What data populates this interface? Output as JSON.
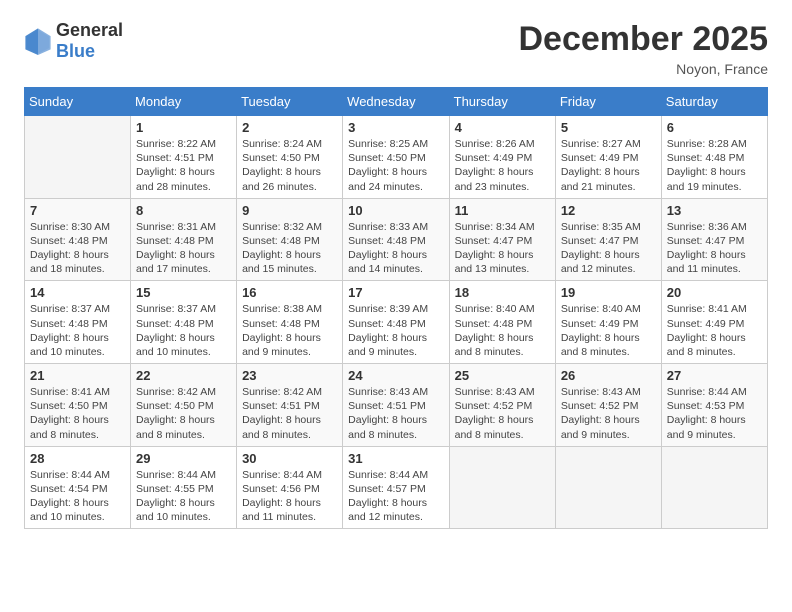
{
  "header": {
    "logo_general": "General",
    "logo_blue": "Blue",
    "title": "December 2025",
    "location": "Noyon, France"
  },
  "days_of_week": [
    "Sunday",
    "Monday",
    "Tuesday",
    "Wednesday",
    "Thursday",
    "Friday",
    "Saturday"
  ],
  "weeks": [
    [
      {
        "day": "",
        "empty": true
      },
      {
        "day": "1",
        "sunrise": "Sunrise: 8:22 AM",
        "sunset": "Sunset: 4:51 PM",
        "daylight": "Daylight: 8 hours and 28 minutes."
      },
      {
        "day": "2",
        "sunrise": "Sunrise: 8:24 AM",
        "sunset": "Sunset: 4:50 PM",
        "daylight": "Daylight: 8 hours and 26 minutes."
      },
      {
        "day": "3",
        "sunrise": "Sunrise: 8:25 AM",
        "sunset": "Sunset: 4:50 PM",
        "daylight": "Daylight: 8 hours and 24 minutes."
      },
      {
        "day": "4",
        "sunrise": "Sunrise: 8:26 AM",
        "sunset": "Sunset: 4:49 PM",
        "daylight": "Daylight: 8 hours and 23 minutes."
      },
      {
        "day": "5",
        "sunrise": "Sunrise: 8:27 AM",
        "sunset": "Sunset: 4:49 PM",
        "daylight": "Daylight: 8 hours and 21 minutes."
      },
      {
        "day": "6",
        "sunrise": "Sunrise: 8:28 AM",
        "sunset": "Sunset: 4:48 PM",
        "daylight": "Daylight: 8 hours and 19 minutes."
      }
    ],
    [
      {
        "day": "7",
        "sunrise": "Sunrise: 8:30 AM",
        "sunset": "Sunset: 4:48 PM",
        "daylight": "Daylight: 8 hours and 18 minutes."
      },
      {
        "day": "8",
        "sunrise": "Sunrise: 8:31 AM",
        "sunset": "Sunset: 4:48 PM",
        "daylight": "Daylight: 8 hours and 17 minutes."
      },
      {
        "day": "9",
        "sunrise": "Sunrise: 8:32 AM",
        "sunset": "Sunset: 4:48 PM",
        "daylight": "Daylight: 8 hours and 15 minutes."
      },
      {
        "day": "10",
        "sunrise": "Sunrise: 8:33 AM",
        "sunset": "Sunset: 4:48 PM",
        "daylight": "Daylight: 8 hours and 14 minutes."
      },
      {
        "day": "11",
        "sunrise": "Sunrise: 8:34 AM",
        "sunset": "Sunset: 4:47 PM",
        "daylight": "Daylight: 8 hours and 13 minutes."
      },
      {
        "day": "12",
        "sunrise": "Sunrise: 8:35 AM",
        "sunset": "Sunset: 4:47 PM",
        "daylight": "Daylight: 8 hours and 12 minutes."
      },
      {
        "day": "13",
        "sunrise": "Sunrise: 8:36 AM",
        "sunset": "Sunset: 4:47 PM",
        "daylight": "Daylight: 8 hours and 11 minutes."
      }
    ],
    [
      {
        "day": "14",
        "sunrise": "Sunrise: 8:37 AM",
        "sunset": "Sunset: 4:48 PM",
        "daylight": "Daylight: 8 hours and 10 minutes."
      },
      {
        "day": "15",
        "sunrise": "Sunrise: 8:37 AM",
        "sunset": "Sunset: 4:48 PM",
        "daylight": "Daylight: 8 hours and 10 minutes."
      },
      {
        "day": "16",
        "sunrise": "Sunrise: 8:38 AM",
        "sunset": "Sunset: 4:48 PM",
        "daylight": "Daylight: 8 hours and 9 minutes."
      },
      {
        "day": "17",
        "sunrise": "Sunrise: 8:39 AM",
        "sunset": "Sunset: 4:48 PM",
        "daylight": "Daylight: 8 hours and 9 minutes."
      },
      {
        "day": "18",
        "sunrise": "Sunrise: 8:40 AM",
        "sunset": "Sunset: 4:48 PM",
        "daylight": "Daylight: 8 hours and 8 minutes."
      },
      {
        "day": "19",
        "sunrise": "Sunrise: 8:40 AM",
        "sunset": "Sunset: 4:49 PM",
        "daylight": "Daylight: 8 hours and 8 minutes."
      },
      {
        "day": "20",
        "sunrise": "Sunrise: 8:41 AM",
        "sunset": "Sunset: 4:49 PM",
        "daylight": "Daylight: 8 hours and 8 minutes."
      }
    ],
    [
      {
        "day": "21",
        "sunrise": "Sunrise: 8:41 AM",
        "sunset": "Sunset: 4:50 PM",
        "daylight": "Daylight: 8 hours and 8 minutes."
      },
      {
        "day": "22",
        "sunrise": "Sunrise: 8:42 AM",
        "sunset": "Sunset: 4:50 PM",
        "daylight": "Daylight: 8 hours and 8 minutes."
      },
      {
        "day": "23",
        "sunrise": "Sunrise: 8:42 AM",
        "sunset": "Sunset: 4:51 PM",
        "daylight": "Daylight: 8 hours and 8 minutes."
      },
      {
        "day": "24",
        "sunrise": "Sunrise: 8:43 AM",
        "sunset": "Sunset: 4:51 PM",
        "daylight": "Daylight: 8 hours and 8 minutes."
      },
      {
        "day": "25",
        "sunrise": "Sunrise: 8:43 AM",
        "sunset": "Sunset: 4:52 PM",
        "daylight": "Daylight: 8 hours and 8 minutes."
      },
      {
        "day": "26",
        "sunrise": "Sunrise: 8:43 AM",
        "sunset": "Sunset: 4:52 PM",
        "daylight": "Daylight: 8 hours and 9 minutes."
      },
      {
        "day": "27",
        "sunrise": "Sunrise: 8:44 AM",
        "sunset": "Sunset: 4:53 PM",
        "daylight": "Daylight: 8 hours and 9 minutes."
      }
    ],
    [
      {
        "day": "28",
        "sunrise": "Sunrise: 8:44 AM",
        "sunset": "Sunset: 4:54 PM",
        "daylight": "Daylight: 8 hours and 10 minutes."
      },
      {
        "day": "29",
        "sunrise": "Sunrise: 8:44 AM",
        "sunset": "Sunset: 4:55 PM",
        "daylight": "Daylight: 8 hours and 10 minutes."
      },
      {
        "day": "30",
        "sunrise": "Sunrise: 8:44 AM",
        "sunset": "Sunset: 4:56 PM",
        "daylight": "Daylight: 8 hours and 11 minutes."
      },
      {
        "day": "31",
        "sunrise": "Sunrise: 8:44 AM",
        "sunset": "Sunset: 4:57 PM",
        "daylight": "Daylight: 8 hours and 12 minutes."
      },
      {
        "day": "",
        "empty": true
      },
      {
        "day": "",
        "empty": true
      },
      {
        "day": "",
        "empty": true
      }
    ]
  ]
}
